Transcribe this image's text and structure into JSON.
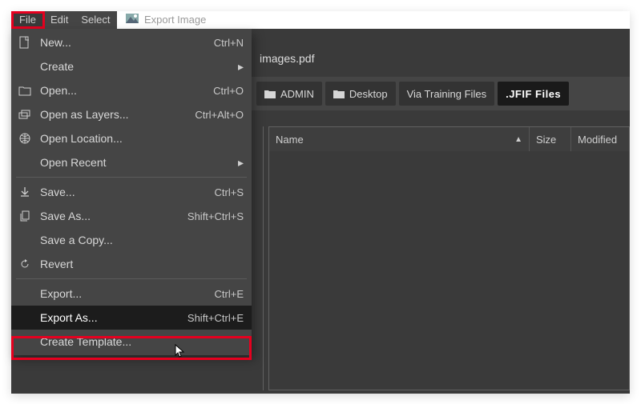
{
  "titlebar": {
    "label": "Export Image"
  },
  "menubar": {
    "file": "File",
    "edit": "Edit",
    "select": "Select"
  },
  "file_menu": {
    "new": {
      "label": "New...",
      "accel": "Ctrl+N"
    },
    "create": {
      "label": "Create"
    },
    "open": {
      "label": "Open...",
      "accel": "Ctrl+O"
    },
    "open_layers": {
      "label": "Open as Layers...",
      "accel": "Ctrl+Alt+O"
    },
    "open_location": {
      "label": "Open Location..."
    },
    "open_recent": {
      "label": "Open Recent"
    },
    "save": {
      "label": "Save...",
      "accel": "Ctrl+S"
    },
    "save_as": {
      "label": "Save As...",
      "accel": "Shift+Ctrl+S"
    },
    "save_copy": {
      "label": "Save a Copy..."
    },
    "revert": {
      "label": "Revert"
    },
    "export": {
      "label": "Export...",
      "accel": "Ctrl+E"
    },
    "export_as": {
      "label": "Export As...",
      "accel": "Shift+Ctrl+E"
    },
    "create_template": {
      "label": "Create Template..."
    }
  },
  "dialog": {
    "filename": "images.pdf",
    "breadcrumbs": {
      "admin": "ADMIN",
      "desktop": "Desktop",
      "via": "Via Training Files",
      "jfif": ".JFIF Files"
    },
    "columns": {
      "name": "Name",
      "size": "Size",
      "modified": "Modified"
    }
  }
}
